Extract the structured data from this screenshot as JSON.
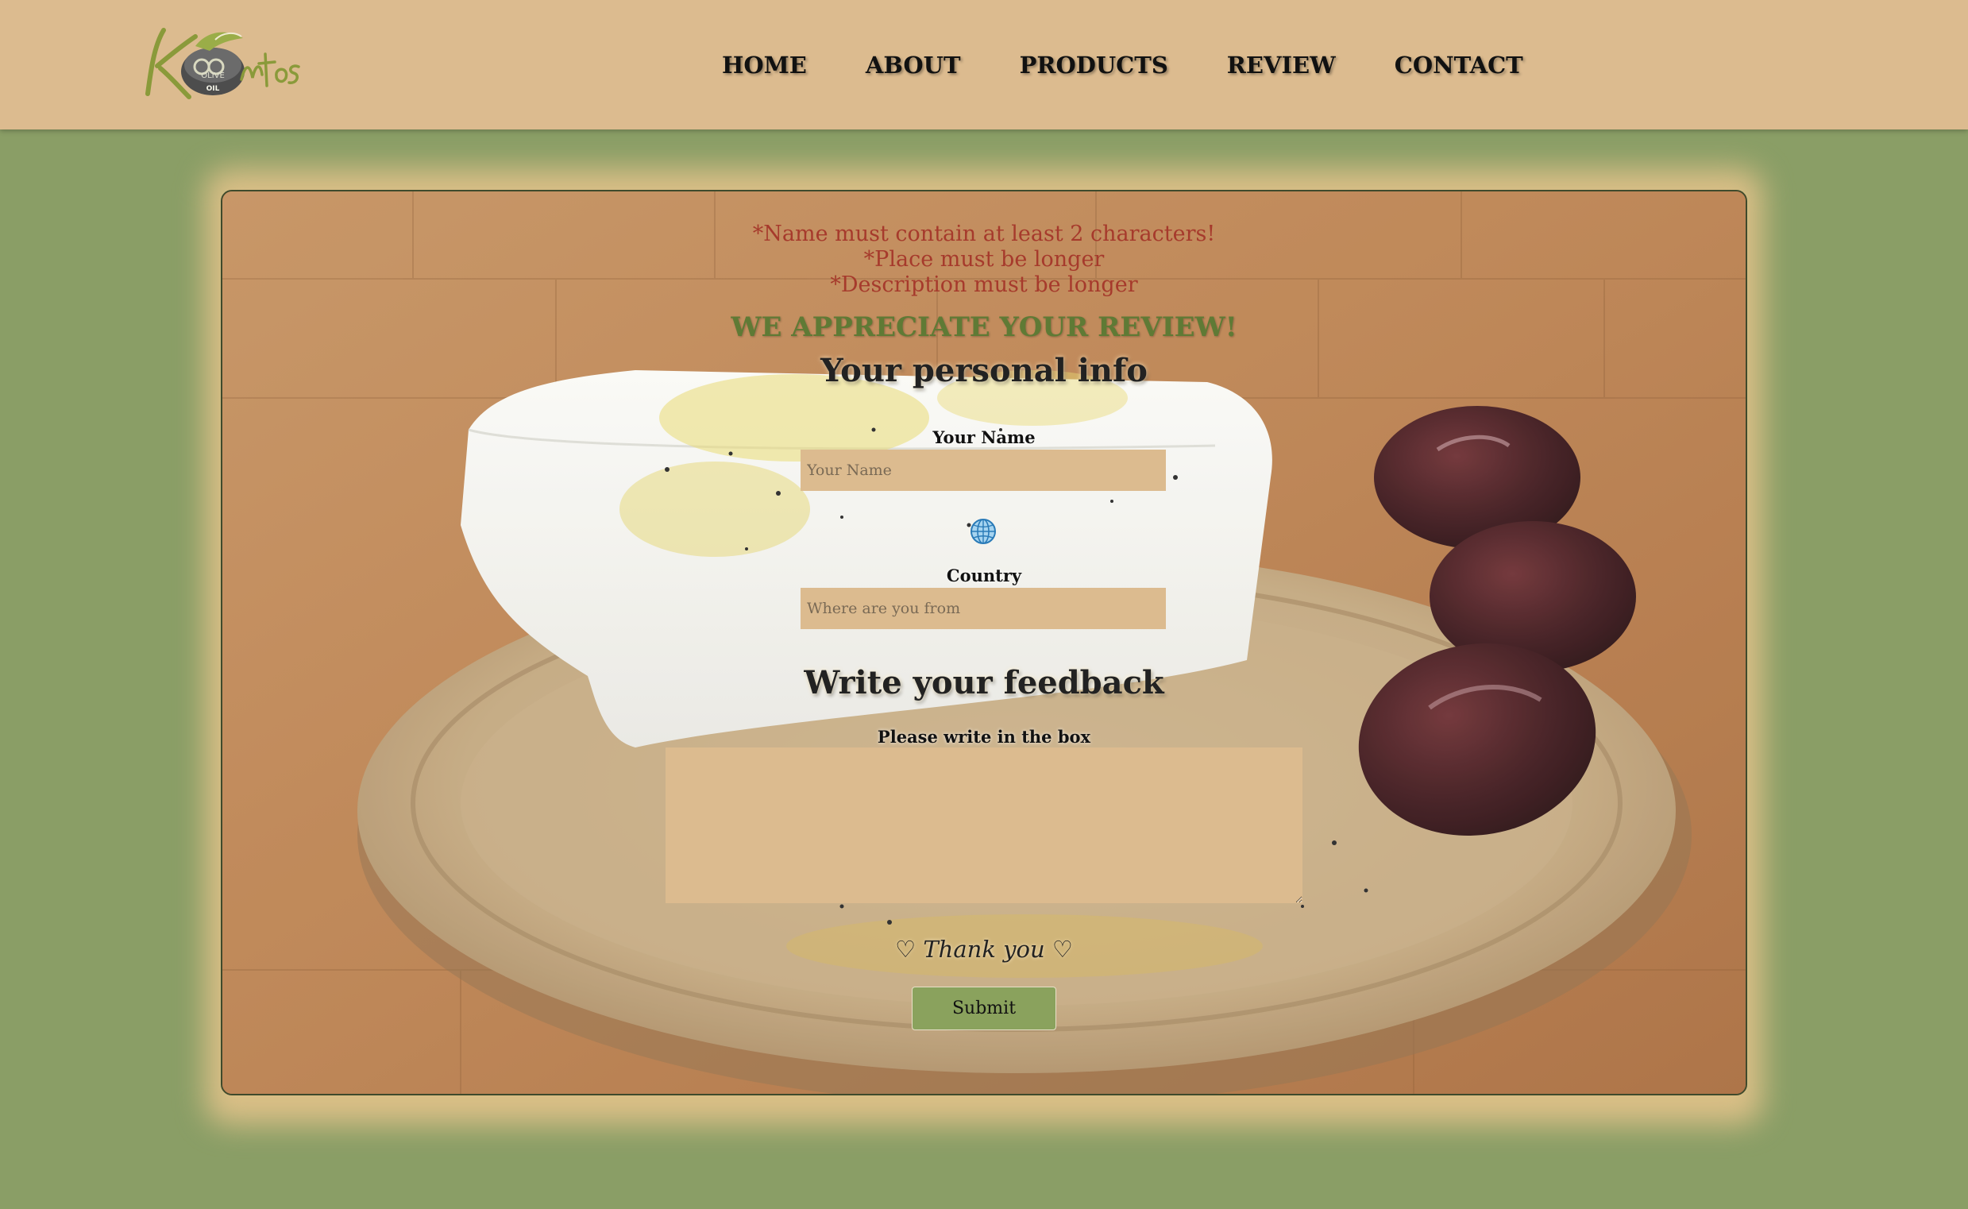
{
  "brand": {
    "logo_text": "Kontos",
    "logo_sub": "OLIVE",
    "logo_oil": "OIL"
  },
  "nav": {
    "items": [
      {
        "label": "HOME"
      },
      {
        "label": "ABOUT"
      },
      {
        "label": "PRODUCTS"
      },
      {
        "label": "REVIEW"
      },
      {
        "label": "CONTACT"
      }
    ]
  },
  "errors": {
    "name": "*Name must contain at least 2 characters!",
    "place": "*Place must be longer",
    "description": "*Description must be longer"
  },
  "form": {
    "appreciate": "WE APPRECIATE YOUR REVIEW!",
    "personal_heading": "Your personal info",
    "name_label": "Your Name",
    "name_placeholder": "Your Name",
    "country_label": "Country",
    "country_placeholder": "Where are you from",
    "feedback_heading": "Write your feedback",
    "feedback_label": "Please write in the box",
    "feedback_value": "",
    "thanks": "♡ Thank you ♡",
    "submit_label": "Submit"
  },
  "colors": {
    "header_bg": "#dcbb8f",
    "page_bg": "#8a9e66",
    "error": "#a63a2c",
    "accent_green": "#5f7a35",
    "submit_bg": "#8aa25d"
  },
  "icons": {
    "globe": "globe-icon"
  }
}
